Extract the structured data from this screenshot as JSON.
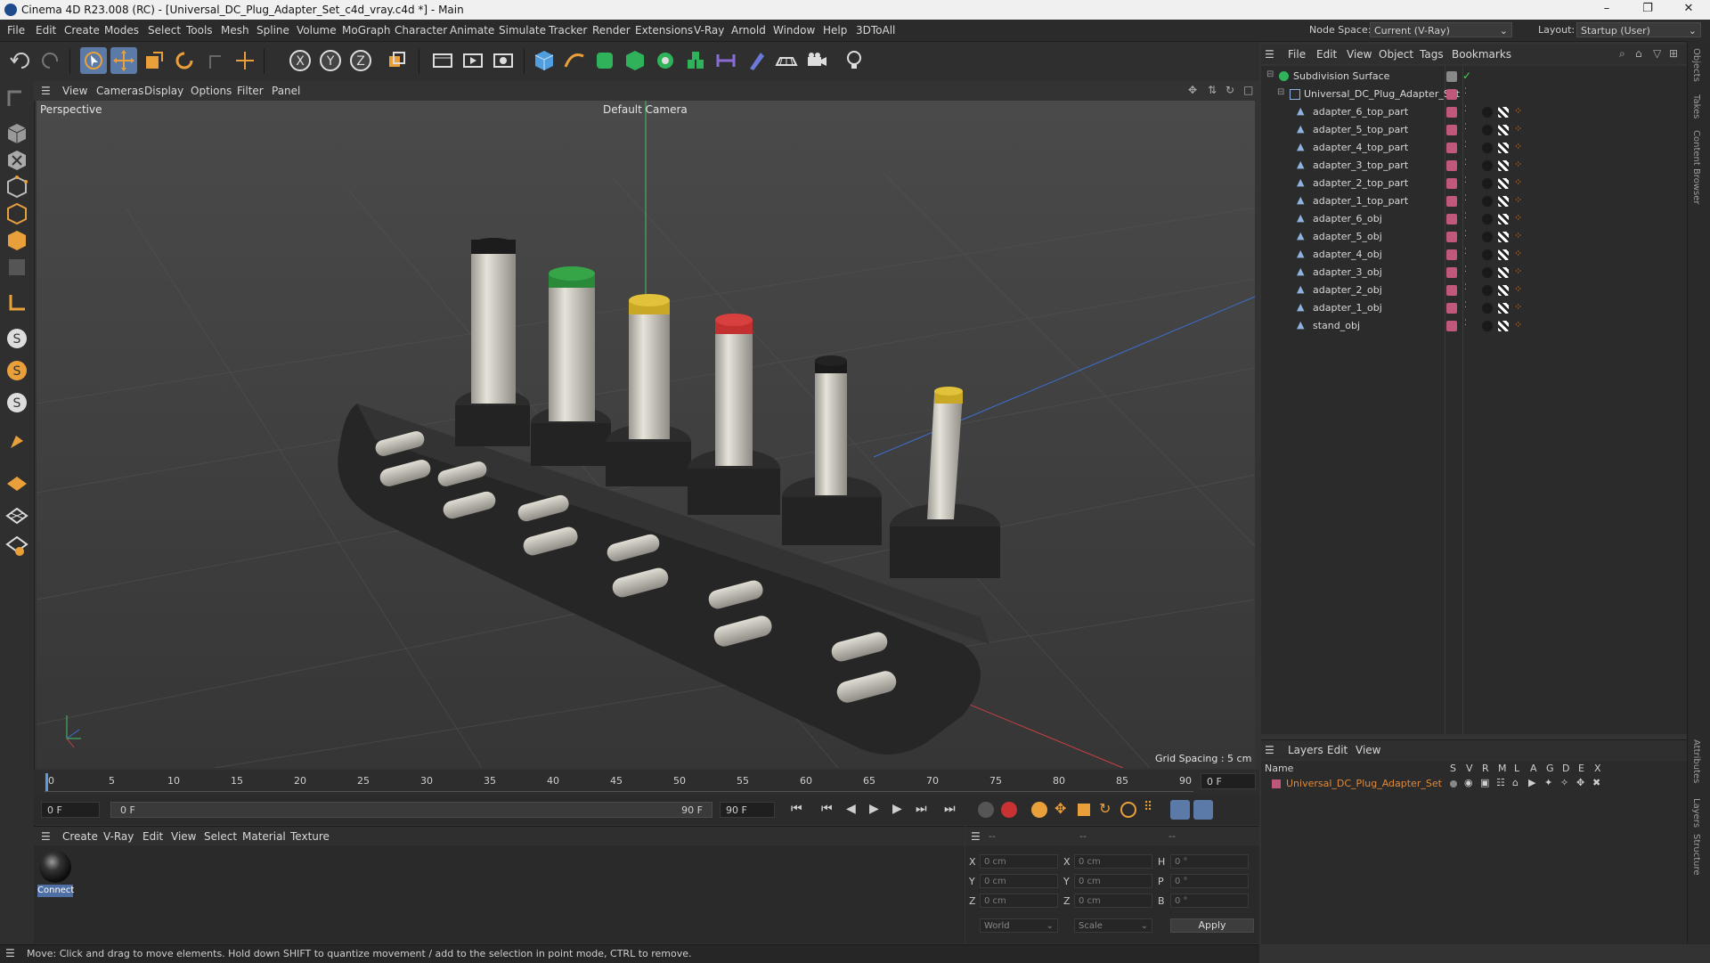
{
  "window": {
    "title": "Cinema 4D R23.008 (RC) - [Universal_DC_Plug_Adapter_Set_c4d_vray.c4d *] - Main",
    "controls": [
      "–",
      "❐",
      "✕"
    ]
  },
  "menubar": [
    "File",
    "Edit",
    "Create",
    "Modes",
    "Select",
    "Tools",
    "Mesh",
    "Spline",
    "Volume",
    "MoGraph",
    "Character",
    "Animate",
    "Simulate",
    "Tracker",
    "Render",
    "Extensions",
    "V-Ray",
    "Arnold",
    "Window",
    "Help",
    "3DToAll"
  ],
  "nodespace": {
    "label": "Node Space:",
    "value": "Current (V-Ray)",
    "layout_label": "Layout:",
    "layout_value": "Startup (User)"
  },
  "viewport": {
    "menu": [
      "View",
      "Cameras",
      "Display",
      "Options",
      "Filter",
      "Panel"
    ],
    "label": "Perspective",
    "camera": "Default Camera",
    "grid_spacing": "Grid Spacing : 5 cm"
  },
  "timeline": {
    "ticks": [
      "0",
      "5",
      "10",
      "15",
      "20",
      "25",
      "30",
      "35",
      "40",
      "45",
      "50",
      "55",
      "60",
      "65",
      "70",
      "75",
      "80",
      "85",
      "90"
    ],
    "current_frame": "0 F",
    "start_field": "0 F",
    "range_start": "0 F",
    "range_end": "90 F",
    "end_field": "90 F"
  },
  "material_manager": {
    "menu": [
      "Create",
      "V-Ray",
      "Edit",
      "View",
      "Select",
      "Material",
      "Texture"
    ],
    "materials": [
      {
        "name": "Connect"
      }
    ]
  },
  "coordinates": {
    "header": [
      "--",
      "--",
      "--"
    ],
    "rows": [
      {
        "a": "X",
        "av": "0 cm",
        "b": "X",
        "bv": "0 cm",
        "c": "H",
        "cv": "0 °"
      },
      {
        "a": "Y",
        "av": "0 cm",
        "b": "Y",
        "bv": "0 cm",
        "c": "P",
        "cv": "0 °"
      },
      {
        "a": "Z",
        "av": "0 cm",
        "b": "Z",
        "bv": "0 cm",
        "c": "B",
        "cv": "0 °"
      }
    ],
    "space": "World",
    "mode": "Scale",
    "apply": "Apply"
  },
  "status": "Move: Click and drag to move elements. Hold down SHIFT to quantize movement / add to the selection in point mode, CTRL to remove.",
  "object_manager": {
    "menu": [
      "File",
      "Edit",
      "View",
      "Object",
      "Tags",
      "Bookmarks"
    ],
    "root": "Subdivision Surface",
    "group": "Universal_DC_Plug_Adapter_Set",
    "objects": [
      "adapter_6_top_part",
      "adapter_5_top_part",
      "adapter_4_top_part",
      "adapter_3_top_part",
      "adapter_2_top_part",
      "adapter_1_top_part",
      "adapter_6_obj",
      "adapter_5_obj",
      "adapter_4_obj",
      "adapter_3_obj",
      "adapter_2_obj",
      "adapter_1_obj",
      "stand_obj"
    ]
  },
  "layer_manager": {
    "menu": [
      "Layers",
      "Edit",
      "View"
    ],
    "columns_name": "Name",
    "columns": [
      "S",
      "V",
      "R",
      "M",
      "L",
      "A",
      "G",
      "D",
      "E",
      "X"
    ],
    "layers": [
      {
        "name": "Universal_DC_Plug_Adapter_Set",
        "color": "#c0587e"
      }
    ]
  },
  "side_tabs": [
    "Objects",
    "Takes",
    "Content Browser",
    "Attributes",
    "Layers",
    "Structure"
  ],
  "colors": {
    "accent": "#5c7aa8",
    "layer_pink": "#c0587e",
    "layer_text": "#e08a3c"
  }
}
